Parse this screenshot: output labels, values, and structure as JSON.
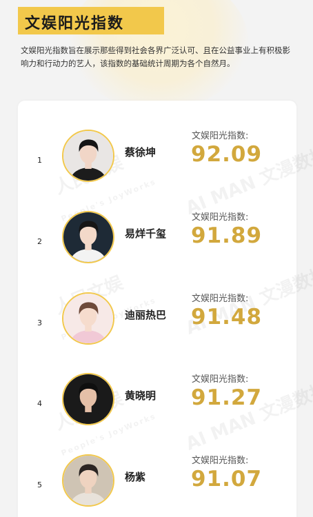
{
  "header": {
    "title": "文娱阳光指数",
    "intro": "文娱阳光指数旨在展示那些得到社会各界广泛认可、且在公益事业上有积极影响力和行动力的艺人，该指数的基础统计周期为各个自然月。"
  },
  "watermark": {
    "brand_text": "人民文娱",
    "brand_sub": "People's JoyWorks",
    "data_text": "AI MAN 文漫数据"
  },
  "ranking": {
    "score_label": "文娱阳光指数:",
    "items": [
      {
        "rank": "1",
        "name": "蔡徐坤",
        "score": "92.09",
        "bg": "#e9e6e4",
        "hair": "#151515",
        "skin": "#f1d6c7",
        "cloth": "#1c1c1c"
      },
      {
        "rank": "2",
        "name": "易烊千玺",
        "score": "91.89",
        "bg": "#1e2a36",
        "hair": "#161616",
        "skin": "#f3d9c9",
        "cloth": "#f3f3f3"
      },
      {
        "rank": "3",
        "name": "迪丽热巴",
        "score": "91.48",
        "bg": "#f7e9e7",
        "hair": "#6e4a3a",
        "skin": "#f6dccd",
        "cloth": "#f1c9d6"
      },
      {
        "rank": "4",
        "name": "黄晓明",
        "score": "91.27",
        "bg": "#1a1a1a",
        "hair": "#0f0f0f",
        "skin": "#e5c0a8",
        "cloth": "#1a1a1a"
      },
      {
        "rank": "5",
        "name": "杨紫",
        "score": "91.07",
        "bg": "#cfc4b4",
        "hair": "#2b2523",
        "skin": "#efd3c0",
        "cloth": "#e8e2da"
      }
    ]
  }
}
